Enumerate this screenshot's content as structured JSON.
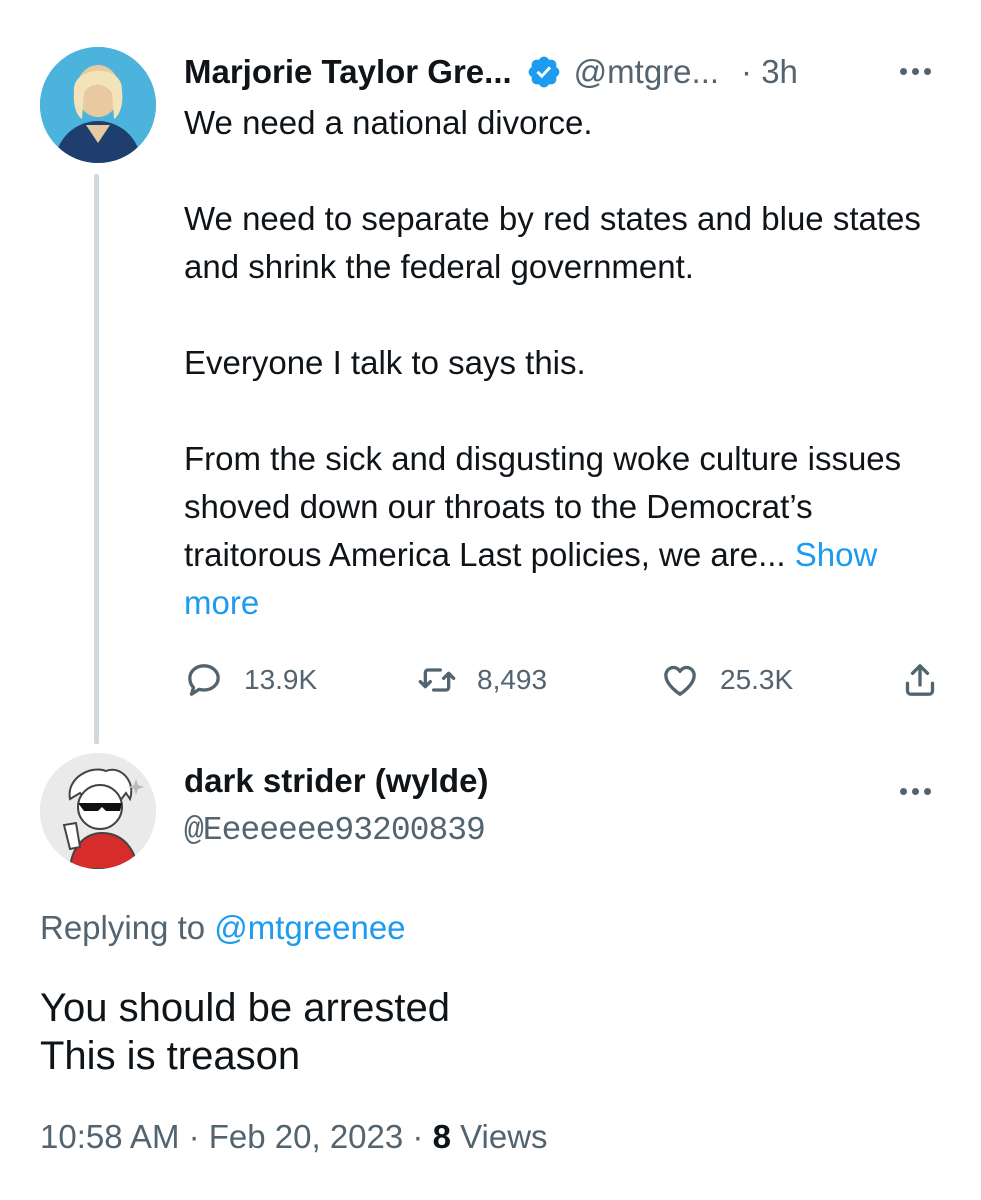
{
  "parent_tweet": {
    "author_name": "Marjorie Taylor Gre...",
    "handle": "@mtgre...",
    "time": "· 3h",
    "paragraphs": [
      "We need a national divorce.",
      "We need to separate by red states and blue states and shrink the federal government.",
      "Everyone I talk to says this.",
      "From the sick and disgusting woke culture issues shoved down our throats to the Democrat’s traitorous America Last policies, we are..."
    ],
    "show_more": "Show more",
    "counts": {
      "replies": "13.9K",
      "retweets": "8,493",
      "likes": "25.3K"
    }
  },
  "reply_tweet": {
    "author_name": "dark strider (wylde)",
    "handle": "@Eeeeeee93200839",
    "replying_prefix": "Replying to ",
    "replying_to": "@mtgreenee",
    "lines": [
      "You should be arrested",
      "This is treason"
    ],
    "timestamp": "10:58 AM · Feb 20, 2023 · ",
    "views_count": "8",
    "views_label": " Views"
  },
  "colors": {
    "text": "#0f1419",
    "secondary": "#536471",
    "accent": "#1d9bf0",
    "thread_line": "#cfd9de"
  },
  "icons": [
    "verified-badge-icon",
    "more-dots-icon",
    "reply-icon",
    "retweet-icon",
    "like-icon",
    "share-icon"
  ]
}
